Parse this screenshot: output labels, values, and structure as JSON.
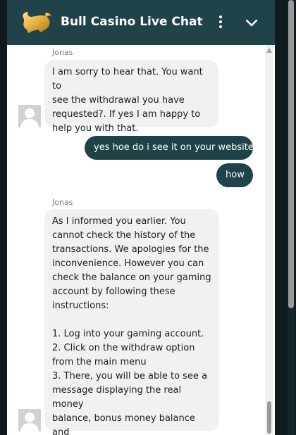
{
  "header": {
    "title": "Bull Casino Live Chat",
    "menu_icon": "more-vertical-icon",
    "collapse_icon": "chevron-down-icon",
    "logo_icon": "gold-bull-logo"
  },
  "messages": [
    {
      "sender": "Jonas",
      "text": "I am sorry to hear that. You want to\nsee the withdrawal you have\nrequested?. If yes I am happy to\nhelp you with that."
    },
    {
      "text": "yes hoe do i see it on your website"
    },
    {
      "text": "how"
    },
    {
      "sender": "Jonas",
      "text": "As I informed you earlier. You\ncannot check the history of the\ntransactions. We apologies for the\ninconvenience. However you can\ncheck the balance on your gaming\naccount by following these\ninstructions:\n\n1. Log into your gaming account.\n2. Click on the withdraw option\nfrom the main menu\n3. There, you will be able to see a\nmessage displaying the real money\nbalance, bonus money balance and\nthe wagering balance."
    }
  ],
  "colors": {
    "header_bg": "#1f4349",
    "agent_bubble_bg": "#f1f1f4",
    "user_bubble_bg": "#1f4349",
    "page_bg": "#0e1a1d"
  }
}
